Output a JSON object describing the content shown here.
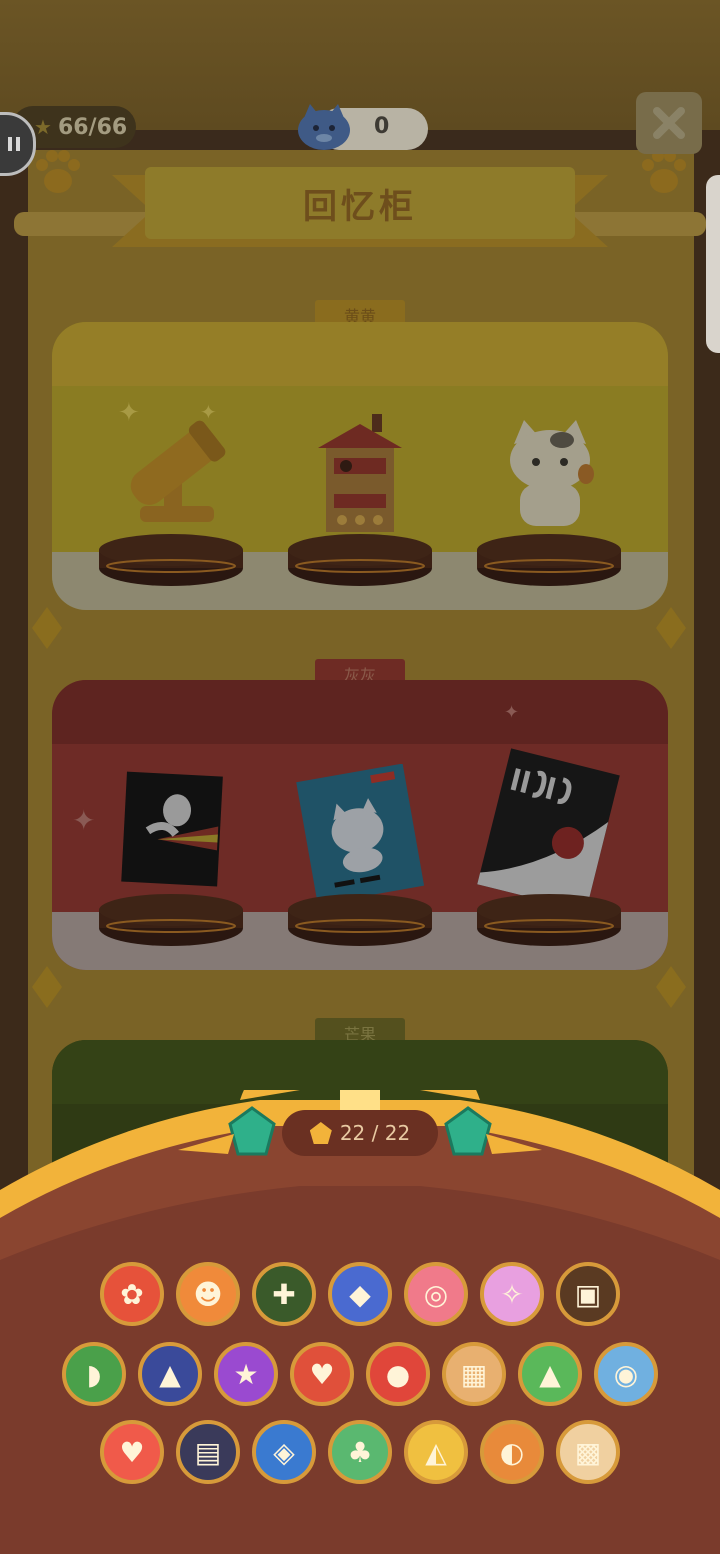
{
  "hud": {
    "pause_icon": "pause-icon",
    "star_count": "66/66",
    "star_icon": "star-icon",
    "currency_icon": "blue-cat-icon",
    "currency_value": "0",
    "close_icon": "close-icon"
  },
  "title": "回忆柜",
  "shelves": [
    {
      "label": "黄黄",
      "items": [
        "golden-cannon-icon",
        "red-roof-house-icon",
        "calico-cat-icon"
      ]
    },
    {
      "label": "灰灰",
      "items": [
        "rainbow-bird-poster-icon",
        "blue-cat-poster-icon",
        "red-fish-poster-icon"
      ]
    },
    {
      "label": "芒果",
      "items": []
    }
  ],
  "collection": {
    "counter": "22 / 22",
    "rows": [
      [
        "flower-badge-icon",
        "panda-shield-icon",
        "gamepad-badge-icon",
        "tie-badge-icon",
        "flamingo-ring-icon",
        "unicorn-badge-icon",
        "treasure-chest-icon"
      ],
      [
        "dinosaur-badge-icon",
        "rocket-badge-icon",
        "star-planet-icon",
        "ice-cream-badge-icon",
        "apple-badge-icon",
        "treasure-map-icon",
        "mountain-badge-icon",
        "spaceship-badge-icon"
      ],
      [
        "balloon-badge-icon",
        "bus-badge-icon",
        "skateboard-badge-icon",
        "watering-can-icon",
        "hat-badge-icon",
        "owl-badge-icon",
        "bread-badge-icon"
      ]
    ]
  },
  "colors": {
    "accent_gold": "#f4b43a",
    "drawer_brown": "#7a3b2e",
    "dim_overlay": "#3a2a1c"
  }
}
